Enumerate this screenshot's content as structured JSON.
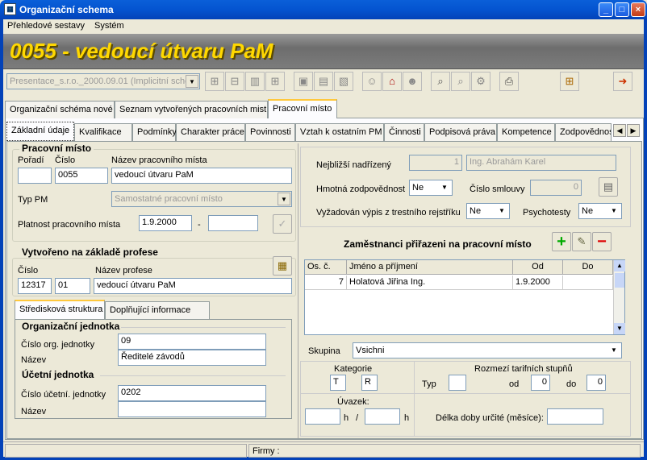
{
  "window": {
    "title": "Organizační schema"
  },
  "menu": {
    "items": [
      "Přehledové sestavy",
      "Systém"
    ]
  },
  "banner": {
    "title": "0055 - vedoucí útvaru PaM"
  },
  "toolbar": {
    "combo_value": "Presentace_s.r.o._2000.09.01  (Implicitní sche"
  },
  "main_tabs": [
    "Organizační schéma nové",
    "Seznam vytvořených pracovních mist",
    "Pracovní místo"
  ],
  "sub_tabs": [
    "Základní údaje",
    "Kvalifikace",
    "Podmínky",
    "Charakter práce",
    "Povinnosti",
    "Vztah k ostatním PM",
    "Činnosti",
    "Podpisová práva",
    "Kompetence",
    "Zodpovědnos"
  ],
  "pm": {
    "group_title": "Pracovní místo",
    "poradi_label": "Pořadí",
    "cislo_label": "Číslo",
    "nazev_label": "Název pracovního místa",
    "poradi": "",
    "cislo": "0055",
    "nazev": "vedoucí útvaru PaM",
    "typ_label": "Typ PM",
    "typ": "Samostatné pracovní místo",
    "platnost_label": "Platnost pracovního místa",
    "platnost_od": "1.9.2000",
    "dash": "-",
    "platnost_do": ""
  },
  "profese": {
    "group_title": "Vytvořeno na základě profese",
    "cislo_label": "Číslo",
    "nazev_label": "Název profese",
    "cislo1": "12317",
    "cislo2": "01",
    "nazev": "vedoucí útvaru PaM"
  },
  "struct_tabs": [
    "Středisková struktura",
    "Doplňující informace"
  ],
  "org": {
    "title": "Organizační jednotka",
    "cislo_label": "Číslo org. jednotky",
    "cislo": "09",
    "nazev_label": "Název",
    "nazev": "Ředitelé závodů"
  },
  "ucet": {
    "title": "Účetní jednotka",
    "cislo_label": "Číslo účetní. jednotky",
    "cislo": "0202",
    "nazev_label": "Název",
    "nazev": ""
  },
  "right": {
    "nadrizeny_label": "Nejbližší nadřízený",
    "nadrizeny_num": "1",
    "nadrizeny_name": "Ing. Abrahám Karel",
    "hmotna_label": "Hmotná zodpovědnost",
    "hmotna": "Ne",
    "smlouva_label": "Číslo smlouvy",
    "smlouva": "0",
    "vypis_label": "Vyžadován výpis z trestního rejstříku",
    "vypis": "Ne",
    "psycho_label": "Psychotesty",
    "psycho": "Ne"
  },
  "employees": {
    "title": "Zaměstnanci přiřazeni na pracovní místo",
    "columns": [
      "Os. č.",
      "Jméno a příjmení",
      "Od",
      "Do"
    ],
    "rows": [
      [
        "7",
        "Holatová Jiřina Ing.",
        "1.9.2000",
        ""
      ]
    ]
  },
  "skupina": {
    "label": "Skupina",
    "value": "Vsichni"
  },
  "kategorie": {
    "label": "Kategorie",
    "v1": "T",
    "v2": "R"
  },
  "rozmezi": {
    "label": "Rozmezí tarifních stupňů",
    "typ_label": "Typ",
    "typ": "",
    "od_label": "od",
    "od": "0",
    "do_label": "do",
    "do": "0"
  },
  "uvazek": {
    "label": "Úvazek:",
    "h1": "",
    "h_unit": "h",
    "slash": "/",
    "h2": "",
    "h_unit2": "h"
  },
  "delka": {
    "label": "Délka doby určité (měsíce):",
    "value": ""
  },
  "statusbar": {
    "firmy": "Firmy :"
  }
}
